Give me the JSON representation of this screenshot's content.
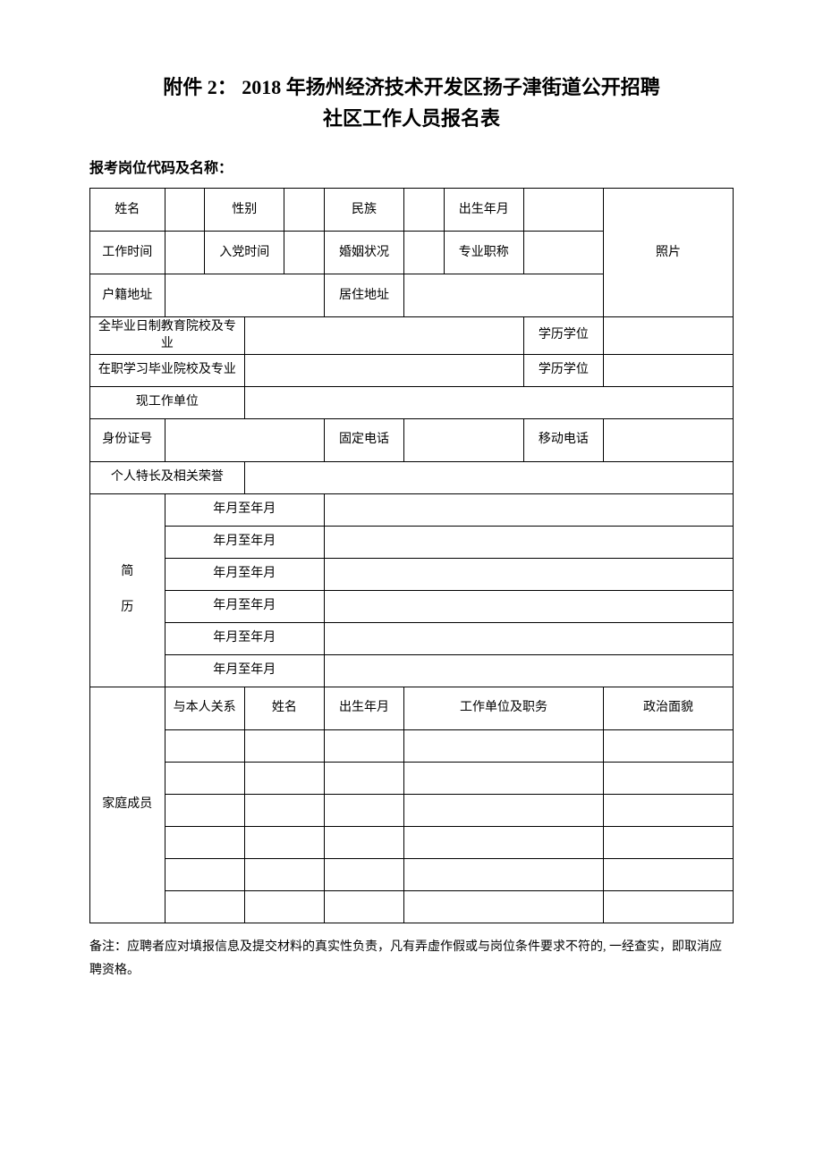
{
  "title_line1": "附件 2： 2018 年扬州经济技术开发区扬子津街道公开招聘",
  "title_line2": "社区工作人员报名表",
  "subhead": "报考岗位代码及名称：",
  "labels": {
    "name": "姓名",
    "gender": "性别",
    "ethnicity": "民族",
    "birth": "出生年月",
    "work_time": "工作时间",
    "party_time": "入党时间",
    "marital": "婚姻状况",
    "pro_title": "专业职称",
    "photo": "照片",
    "hukou": "户籍地址",
    "residence": "居住地址",
    "fulltime_edu": "全毕业日制教育院校及专业",
    "degree1": "学历学位",
    "onjob_edu": "在职学习毕业院校及专业",
    "degree2": "学历学位",
    "current_unit": "现工作单位",
    "id_no": "身份证号",
    "fixed_phone": "固定电话",
    "mobile": "移动电话",
    "strengths": "个人特长及相关荣誉",
    "resume": "简",
    "resume2": "历",
    "period": "年月至年月",
    "family": "家庭成员",
    "relation": "与本人关系",
    "fam_name": "姓名",
    "fam_birth": "出生年月",
    "fam_work": "工作单位及职务",
    "fam_politics": "政治面貌"
  },
  "note": "备注：应聘者应对填报信息及提交材料的真实性负责，凡有弄虚作假或与岗位条件要求不符的, 一经查实，即取消应聘资格。"
}
